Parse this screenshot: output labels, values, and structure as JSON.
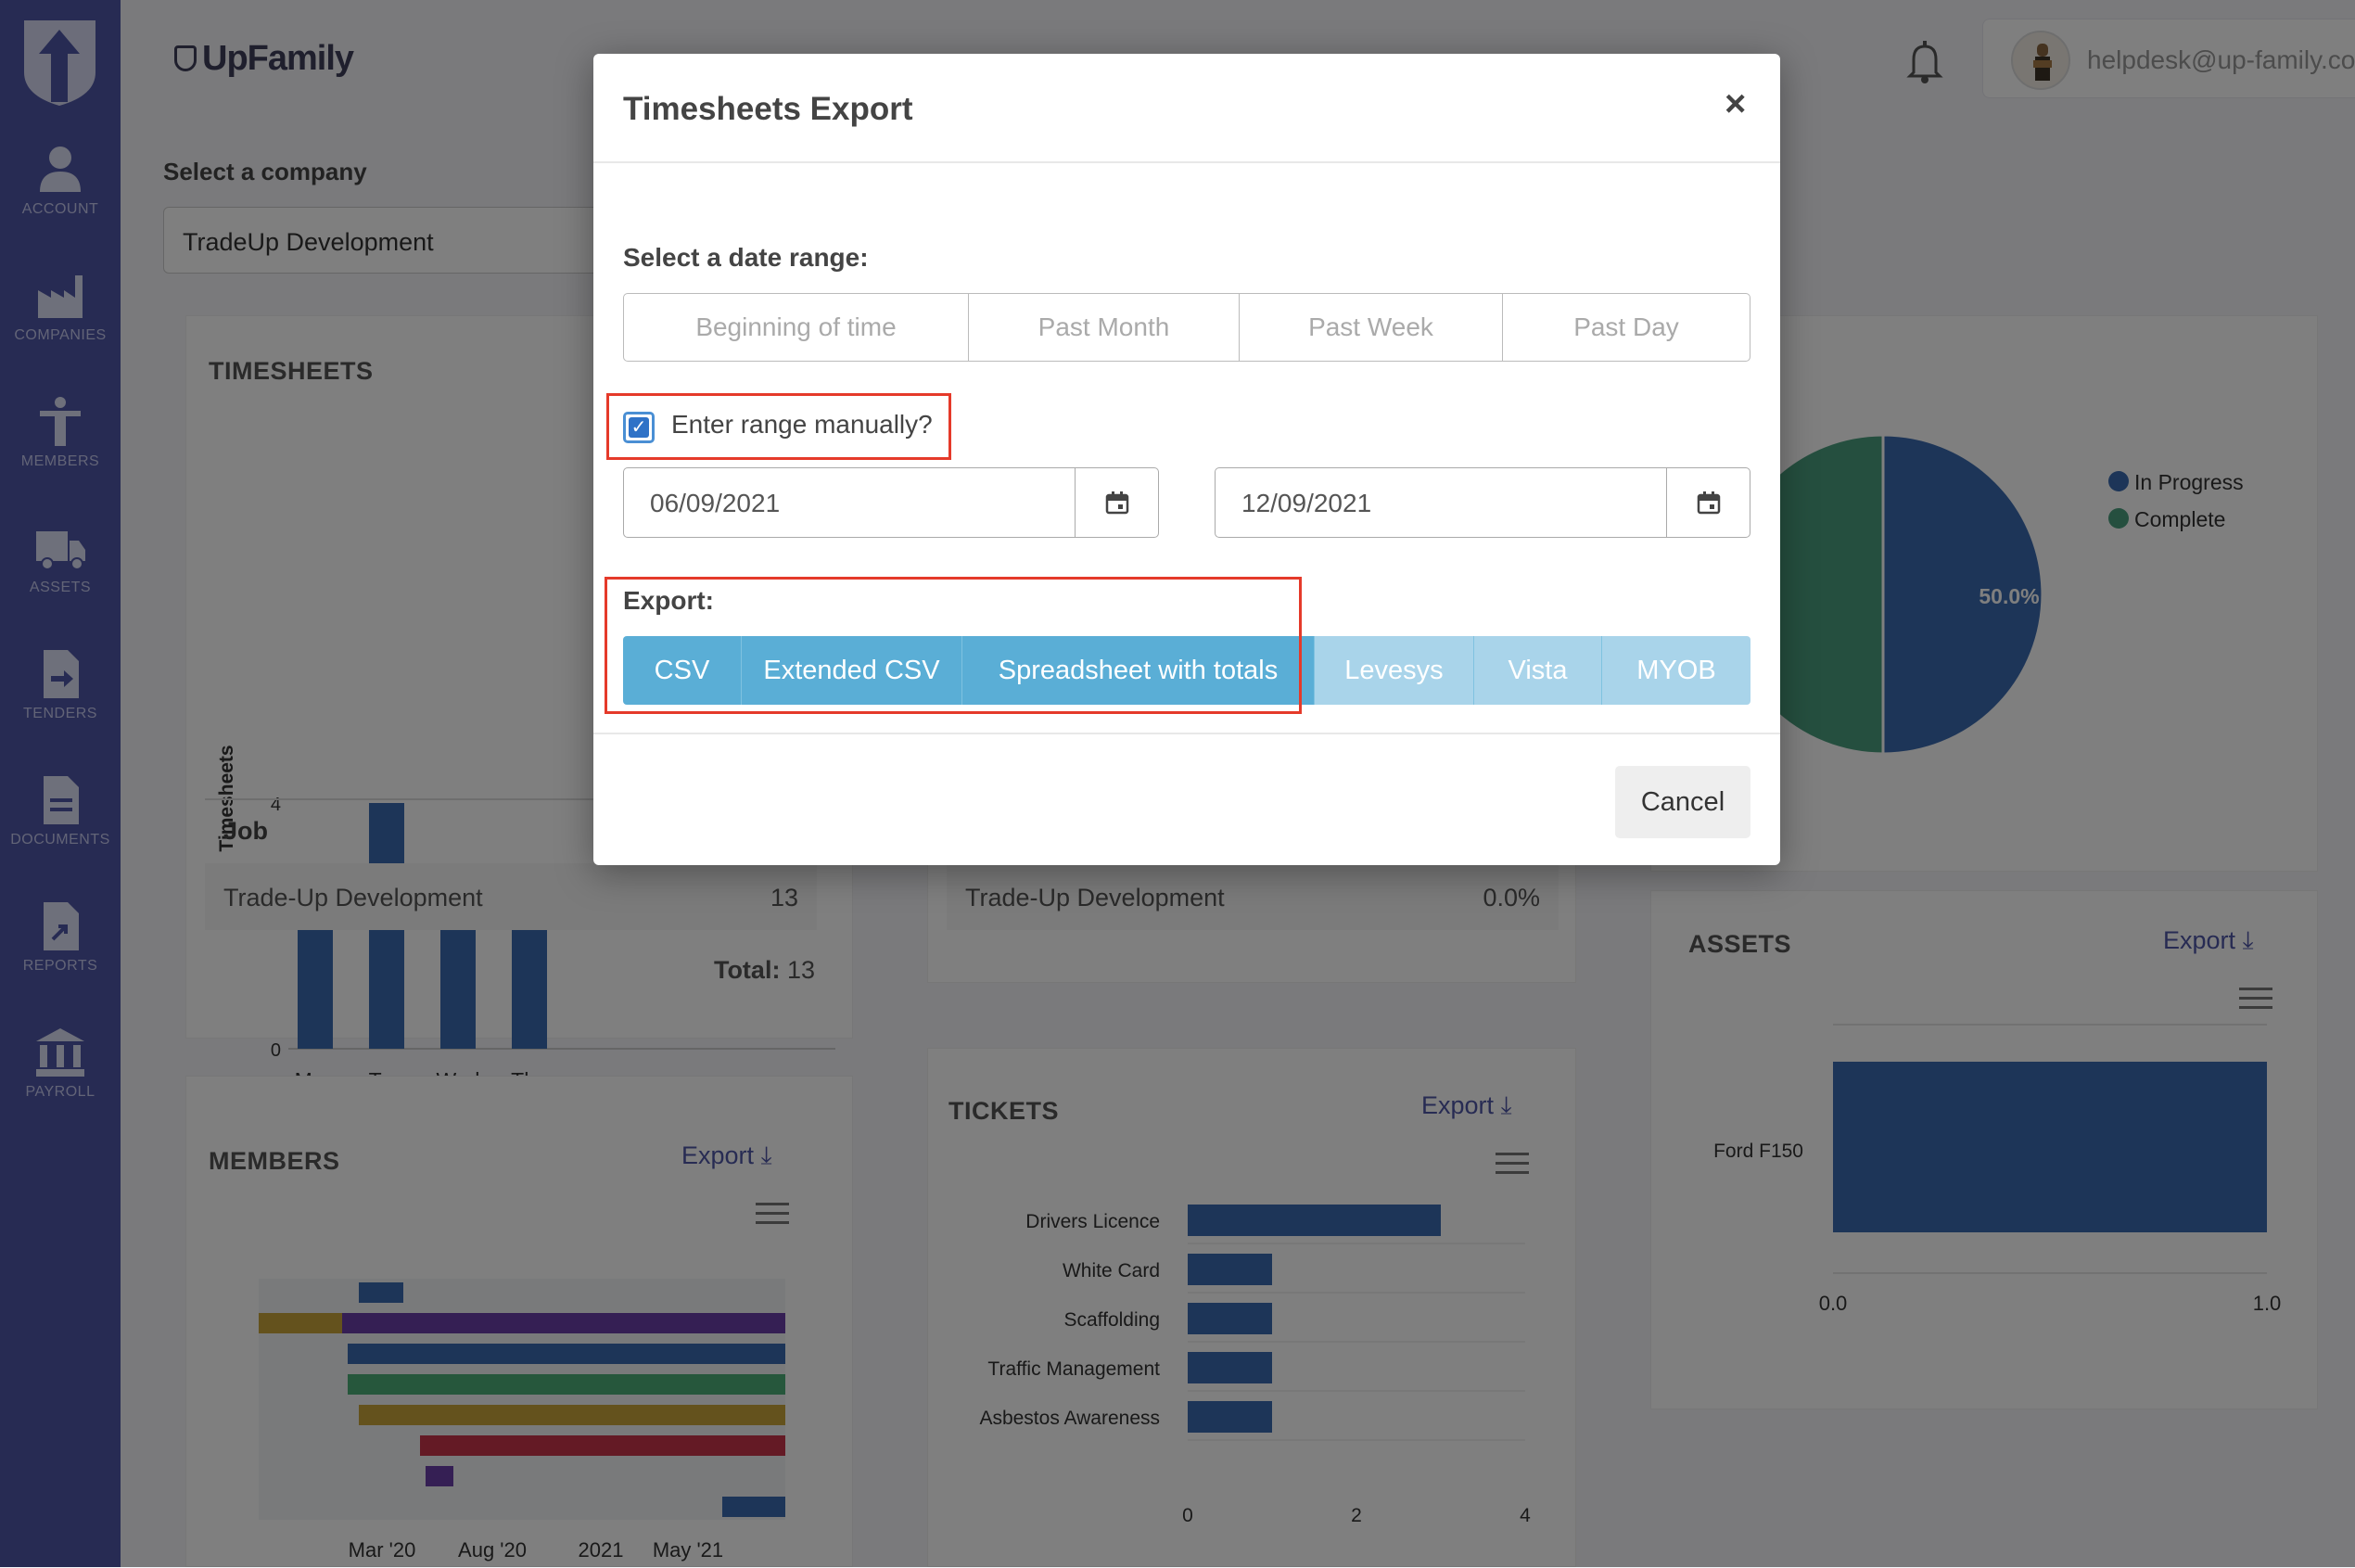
{
  "sidebar": {
    "items": [
      {
        "label": "ACCOUNT",
        "icon": "person-icon"
      },
      {
        "label": "COMPANIES",
        "icon": "factory-icon"
      },
      {
        "label": "MEMBERS",
        "icon": "worker-icon"
      },
      {
        "label": "ASSETS",
        "icon": "truck-icon"
      },
      {
        "label": "TENDERS",
        "icon": "document-arrow-icon"
      },
      {
        "label": "DOCUMENTS",
        "icon": "document-icon"
      },
      {
        "label": "REPORTS",
        "icon": "report-icon"
      },
      {
        "label": "PAYROLL",
        "icon": "bank-icon"
      }
    ]
  },
  "header": {
    "brand": "UpFamily",
    "user_email": "helpdesk@up-family.com.au"
  },
  "company": {
    "label": "Select a company",
    "selected": "TradeUp Development"
  },
  "timesheets": {
    "title": "TIMESHEETS",
    "job_header": "Job",
    "row_name": "Trade-Up Development",
    "row_value": "13",
    "total_label": "Total:",
    "total_value": "13"
  },
  "middle_card": {
    "row_name": "Trade-Up Development",
    "row_value": "0.0%"
  },
  "members": {
    "title": "MEMBERS",
    "export_label": "Export"
  },
  "tickets": {
    "title": "TICKETS",
    "export_label": "Export"
  },
  "assets": {
    "title": "ASSETS",
    "export_label": "Export"
  },
  "chart_data": [
    {
      "type": "bar",
      "ylabel": "Timesheets",
      "categories": [
        "Mon",
        "Tue",
        "Wed",
        "Thu"
      ],
      "values": [
        3,
        4,
        3,
        2
      ],
      "yticks": [
        "0",
        "4"
      ],
      "ylim": [
        0,
        4
      ]
    },
    {
      "type": "pie",
      "labels": [
        "In Progress",
        "Complete"
      ],
      "values": [
        50.0,
        50.0
      ],
      "slice_label": "50.0%",
      "colors": [
        "#3a6bb0",
        "#4a9e7e"
      ]
    },
    {
      "type": "bar",
      "orientation": "horizontal",
      "categories": [
        "Drivers Licence",
        "White Card",
        "Scaffolding",
        "Traffic Management",
        "Asbestos Awareness"
      ],
      "values": [
        3,
        1,
        1,
        1,
        1
      ],
      "xticks": [
        "0",
        "2",
        "4"
      ],
      "xlim": [
        0,
        4
      ]
    },
    {
      "type": "bar",
      "orientation": "horizontal",
      "categories": [
        "Ford F150"
      ],
      "values": [
        1
      ],
      "xticks": [
        "0.0",
        "1.0"
      ],
      "xlim": [
        0,
        1
      ]
    },
    {
      "type": "timeline",
      "xticks": [
        "Mar '20",
        "Aug '20",
        "2021",
        "May '21"
      ]
    }
  ],
  "modal": {
    "title": "Timesheets Export",
    "close": "×",
    "date_range_label": "Select a date range:",
    "ranges": [
      "Beginning of time",
      "Past Month",
      "Past Week",
      "Past Day"
    ],
    "manual_label": "Enter range manually?",
    "manual_checked": true,
    "start_date": "06/09/2021",
    "end_date": "12/09/2021",
    "export_label": "Export:",
    "export_options": [
      "CSV",
      "Extended CSV",
      "Spreadsheet with totals",
      "Levesys",
      "Vista",
      "MYOB"
    ],
    "cancel": "Cancel"
  },
  "colors": {
    "sidebar": "#4f56a6",
    "export_primary": "#5aaed6",
    "export_secondary": "#a9d4ea",
    "highlight": "#e53a2a",
    "bar": "#3a6bb0"
  }
}
